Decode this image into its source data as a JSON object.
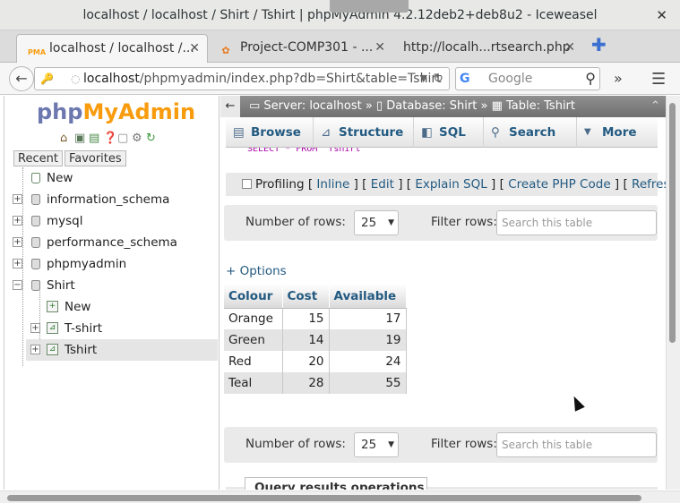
{
  "window": {
    "title": "localhost / localhost / Shirt / Tshirt | phpMyAdmin 4.2.12deb2+deb8u2 - Iceweasel",
    "close_glyph": "✕"
  },
  "tabs": [
    {
      "label": "localhost / localhost /...",
      "favicon": "PMA",
      "close": "✕"
    },
    {
      "label": "Project-COMP301 - ...",
      "favicon": "✿",
      "close": "✕"
    },
    {
      "label": "http://localh...rtsearch.php",
      "close": "✕"
    }
  ],
  "new_tab_glyph": "✚",
  "navbar": {
    "back_glyph": "←",
    "url_host": "localhost",
    "url_path": "/phpmyadmin/index.php?db=Shirt&table=Tshirt",
    "search_engine_glyph": "G",
    "search_placeholder": "Google",
    "overflow_glyph": "»",
    "menu_glyph": "☰"
  },
  "sidebar": {
    "logo_php": "php",
    "logo_myadmin": "MyAdmin",
    "tabs": [
      "Recent",
      "Favorites"
    ],
    "tree": [
      {
        "label": "New",
        "level": 0
      },
      {
        "label": "information_schema",
        "level": 0
      },
      {
        "label": "mysql",
        "level": 0
      },
      {
        "label": "performance_schema",
        "level": 0
      },
      {
        "label": "phpmyadmin",
        "level": 0
      },
      {
        "label": "Shirt",
        "level": 0
      },
      {
        "label": "New",
        "level": 1
      },
      {
        "label": "T-shirt",
        "level": 1
      },
      {
        "label": "Tshirt",
        "level": 1
      }
    ]
  },
  "main": {
    "breadcrumb": {
      "server": "Server: localhost",
      "database": "Database: Shirt",
      "table": "Table: Tshirt",
      "sep": "»"
    },
    "tabs": [
      "Browse",
      "Structure",
      "SQL",
      "Search",
      "More"
    ],
    "sql_peek": "SELECT * FROM `Tshirt`",
    "profiling": {
      "label": "Profiling",
      "links": [
        "Inline",
        "Edit",
        "Explain SQL",
        "Create PHP Code",
        "Refresh"
      ]
    },
    "nav": {
      "rows_label": "Number of rows:",
      "rows_value": "25",
      "filter_label": "Filter rows:",
      "filter_placeholder": "Search this table"
    },
    "options_label": "+ Options",
    "table": {
      "headers": [
        "Colour",
        "Cost",
        "Available"
      ],
      "rows": [
        [
          "Orange",
          "15",
          "17"
        ],
        [
          "Green",
          "14",
          "19"
        ],
        [
          "Red",
          "20",
          "24"
        ],
        [
          "Teal",
          "28",
          "55"
        ]
      ]
    },
    "query_ops_label": "Query results operations"
  }
}
